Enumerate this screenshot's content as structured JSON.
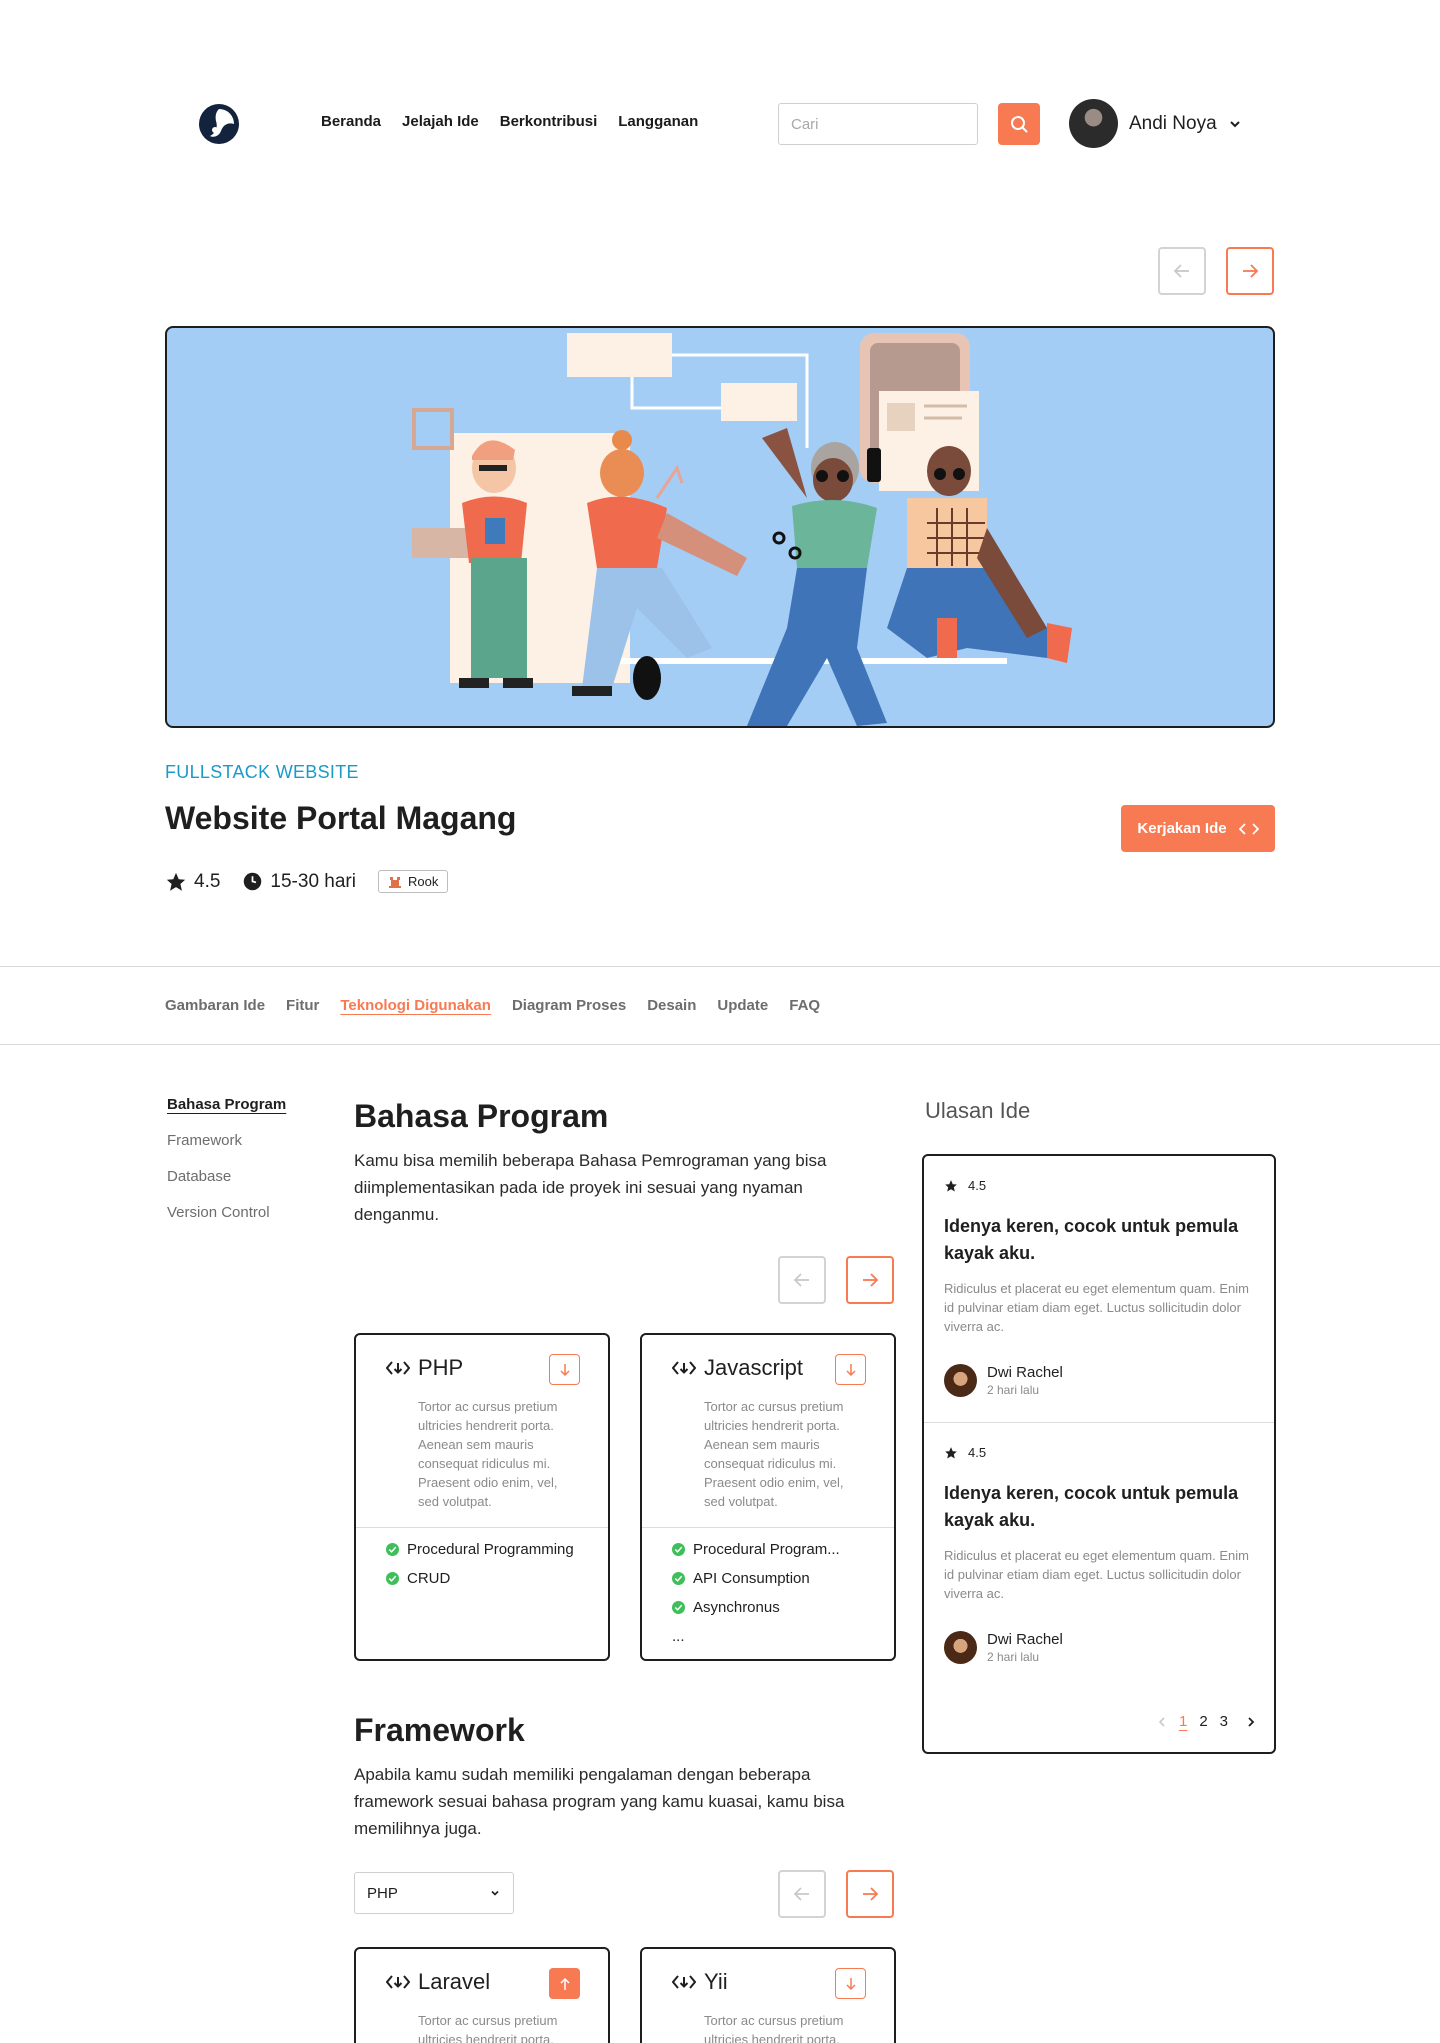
{
  "header": {
    "nav": [
      "Beranda",
      "Jelajah Ide",
      "Berkontribusi",
      "Langganan"
    ],
    "search_placeholder": "Cari",
    "user_name": "Andi Noya"
  },
  "hero": {
    "category": "FULLSTACK WEBSITE",
    "title": "Website Portal Magang",
    "cta_label": "Kerjakan Ide",
    "rating": "4.5",
    "duration": "15-30 hari",
    "level_badge": "Rook"
  },
  "tabs": [
    "Gambaran Ide",
    "Fitur",
    "Teknologi Digunakan",
    "Diagram Proses",
    "Desain",
    "Update",
    "FAQ"
  ],
  "active_tab": "Teknologi Digunakan",
  "sidenav": [
    "Bahasa Program",
    "Framework",
    "Database",
    "Version Control"
  ],
  "bahasa": {
    "title": "Bahasa Program",
    "desc": "Kamu bisa memilih beberapa Bahasa Pemrograman yang bisa diimplementasikan pada ide proyek ini sesuai yang nyaman denganmu.",
    "cards": [
      {
        "name": "PHP",
        "desc": "Tortor ac cursus pretium ultricies hendrerit porta. Aenean sem mauris consequat ridiculus mi. Praesent odio enim, vel, sed volutpat.",
        "features": [
          "Procedural Programming",
          "CRUD"
        ]
      },
      {
        "name": "Javascript",
        "desc": "Tortor ac cursus pretium ultricies hendrerit porta. Aenean sem mauris consequat ridiculus mi. Praesent odio enim, vel, sed volutpat.",
        "features": [
          "Procedural Program...",
          "API Consumption",
          "Asynchronus"
        ],
        "more": "..."
      }
    ]
  },
  "framework": {
    "title": "Framework",
    "desc": "Apabila kamu sudah memiliki pengalaman dengan beberapa framework sesuai bahasa program yang kamu kuasai, kamu bisa memilihnya juga.",
    "select_value": "PHP",
    "cards": [
      {
        "name": "Laravel",
        "desc": "Tortor ac cursus pretium ultricies hendrerit porta."
      },
      {
        "name": "Yii",
        "desc": "Tortor ac cursus pretium ultricies hendrerit porta."
      }
    ]
  },
  "reviews": {
    "heading": "Ulasan Ide",
    "items": [
      {
        "rating": "4.5",
        "title": "Idenya keren, cocok untuk pemula kayak aku.",
        "body": "Ridiculus et placerat eu eget elementum quam. Enim id pulvinar etiam diam eget. Luctus sollicitudin dolor viverra ac.",
        "author": "Dwi Rachel",
        "time": "2 hari lalu"
      },
      {
        "rating": "4.5",
        "title": "Idenya keren, cocok untuk pemula kayak aku.",
        "body": "Ridiculus et placerat eu eget elementum quam. Enim id pulvinar etiam diam eget. Luctus sollicitudin dolor viverra ac.",
        "author": "Dwi Rachel",
        "time": "2 hari lalu"
      }
    ],
    "pages": [
      "1",
      "2",
      "3"
    ],
    "current_page": "1"
  },
  "colors": {
    "accent": "#f77a52",
    "category": "#1a9ac9",
    "hero_bg": "#a3cdf5",
    "check": "#3fbf5a"
  },
  "icons": [
    "logo-icon",
    "search-icon",
    "chevron-down-icon",
    "arrow-left-icon",
    "arrow-right-icon",
    "code-icon",
    "star-icon",
    "clock-icon",
    "download-icon",
    "upload-icon",
    "check-circle-icon",
    "chevron-left-icon",
    "chevron-right-icon"
  ]
}
